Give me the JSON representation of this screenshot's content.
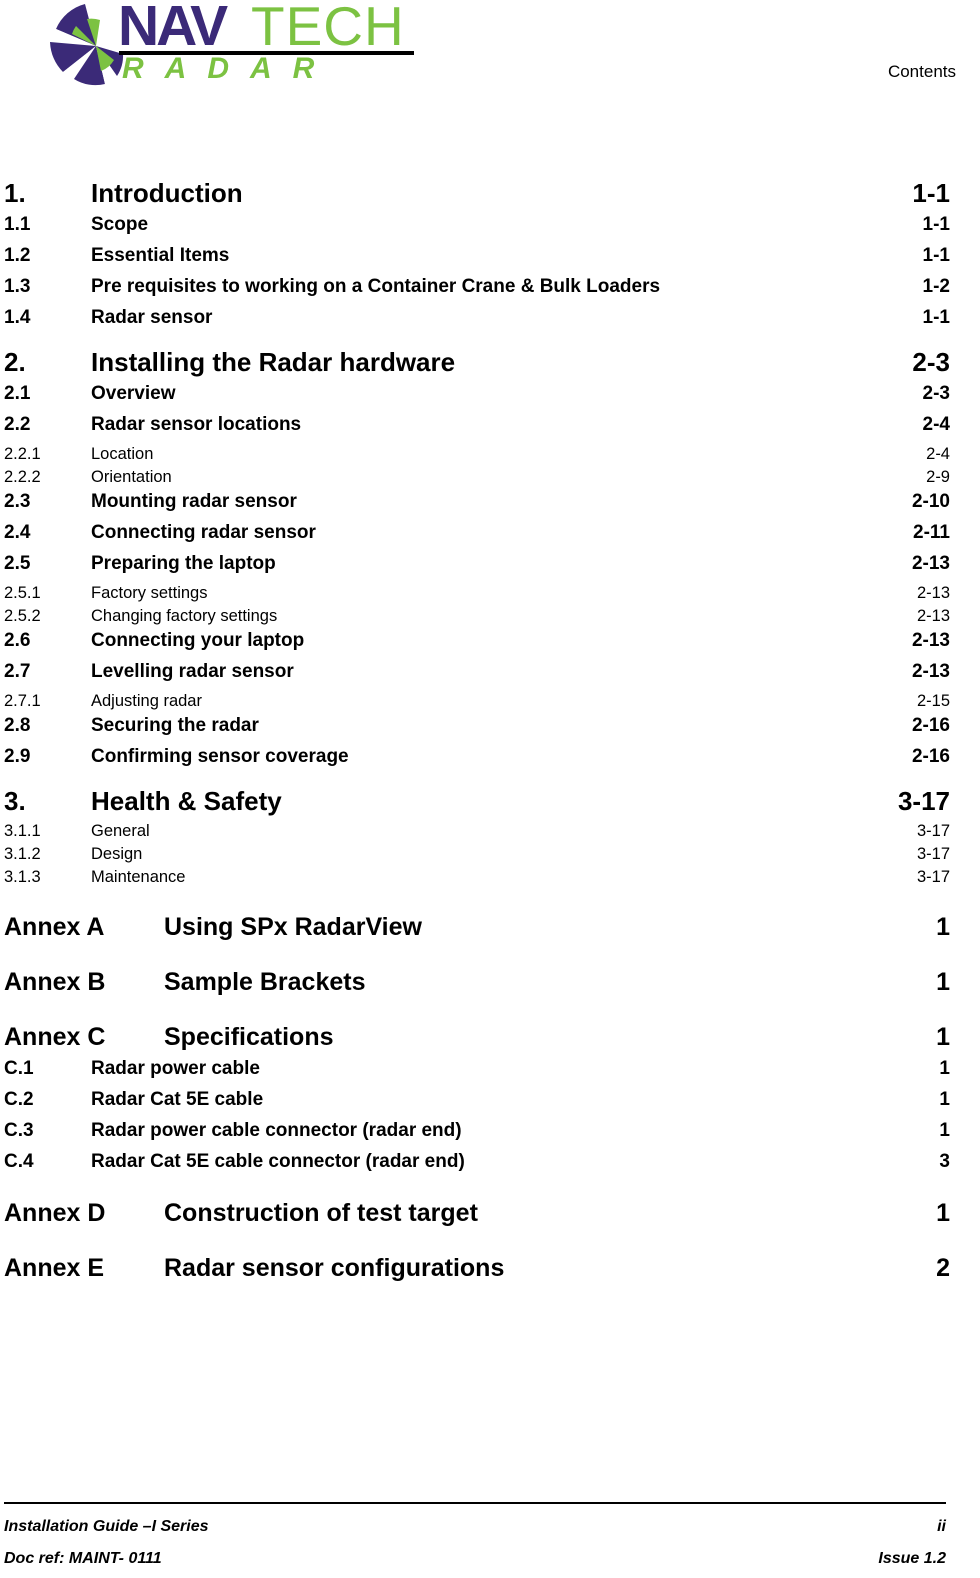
{
  "header": {
    "logo": {
      "mark_name": "navtech-radar-pinwheel-logo",
      "word_nav": "NAV",
      "word_tech": "TECH",
      "word_radar": "RADAR",
      "purple": "#3B2A78",
      "green": "#7CC242"
    },
    "title": "Contents"
  },
  "toc": {
    "entries": [
      {
        "level": 1,
        "number": "1.",
        "title": "Introduction",
        "page": "1-1",
        "gap": false
      },
      {
        "level": 2,
        "number": "1.1",
        "title": "Scope",
        "page": "1-1",
        "gap": false
      },
      {
        "level": 2,
        "number": "1.2",
        "title": "Essential Items",
        "page": "1-1",
        "gap": false
      },
      {
        "level": 2,
        "number": "1.3",
        "title": "Pre requisites to working on a Container Crane & Bulk Loaders",
        "page": "1-2",
        "gap": false
      },
      {
        "level": 2,
        "number": "1.4",
        "title": "Radar sensor",
        "page": "1-1",
        "gap": false
      },
      {
        "level": 1,
        "number": "2.",
        "title": "Installing the Radar hardware",
        "page": "2-3",
        "gap": false
      },
      {
        "level": 2,
        "number": "2.1",
        "title": "Overview",
        "page": "2-3",
        "gap": false
      },
      {
        "level": 2,
        "number": "2.2",
        "title": "Radar sensor locations",
        "page": "2-4",
        "gap": false
      },
      {
        "level": 3,
        "number": "2.2.1",
        "title": "Location",
        "page": "2-4",
        "gap": false
      },
      {
        "level": 3,
        "number": "2.2.2",
        "title": "Orientation",
        "page": "2-9",
        "gap": false
      },
      {
        "level": 2,
        "number": "2.3",
        "title": "Mounting radar sensor",
        "page": "2-10",
        "gap": false
      },
      {
        "level": 2,
        "number": "2.4",
        "title": "Connecting radar sensor",
        "page": "2-11",
        "gap": false
      },
      {
        "level": 2,
        "number": "2.5",
        "title": "Preparing the laptop",
        "page": "2-13",
        "gap": false
      },
      {
        "level": 3,
        "number": "2.5.1",
        "title": "Factory settings",
        "page": "2-13",
        "gap": false
      },
      {
        "level": 3,
        "number": "2.5.2",
        "title": "Changing factory settings",
        "page": "2-13",
        "gap": false
      },
      {
        "level": 2,
        "number": "2.6",
        "title": "Connecting your laptop",
        "page": "2-13",
        "gap": false
      },
      {
        "level": 2,
        "number": "2.7",
        "title": "Levelling radar sensor",
        "page": "2-13",
        "gap": false
      },
      {
        "level": 3,
        "number": "2.7.1",
        "title": "Adjusting radar",
        "page": "2-15",
        "gap": false
      },
      {
        "level": 2,
        "number": "2.8",
        "title": "Securing the radar",
        "page": "2-16",
        "gap": false
      },
      {
        "level": 2,
        "number": "2.9",
        "title": "Confirming sensor coverage",
        "page": "2-16",
        "gap": false
      },
      {
        "level": 1,
        "number": "3.",
        "title": "Health & Safety",
        "page": "3-17",
        "gap": false
      },
      {
        "level": 3,
        "number": "3.1.1",
        "title": "General",
        "page": "3-17",
        "gap": false
      },
      {
        "level": 3,
        "number": "3.1.2",
        "title": "Design",
        "page": "3-17",
        "gap": false
      },
      {
        "level": 3,
        "number": "3.1.3",
        "title": "Maintenance",
        "page": "3-17",
        "gap": false
      },
      {
        "level": 0,
        "number": "Annex A",
        "title": "Using SPx RadarView",
        "page": "1",
        "gap": false
      },
      {
        "level": 0,
        "number": "Annex B",
        "title": "Sample Brackets",
        "page": "1",
        "gap": false
      },
      {
        "level": 0,
        "number": "Annex C",
        "title": "Specifications",
        "page": "1",
        "gap": false
      },
      {
        "level": 4,
        "number": "C.1",
        "title": "Radar power cable",
        "page": "1",
        "gap": false
      },
      {
        "level": 4,
        "number": "C.2",
        "title": "Radar Cat 5E cable",
        "page": "1",
        "gap": false
      },
      {
        "level": 4,
        "number": "C.3",
        "title": "Radar power cable connector (radar end)",
        "page": "1",
        "gap": false
      },
      {
        "level": 4,
        "number": "C.4",
        "title": "Radar Cat 5E cable connector (radar end)",
        "page": "3",
        "gap": false
      },
      {
        "level": 0,
        "number": "Annex D",
        "title": "Construction of test target",
        "page": "1",
        "gap": false
      },
      {
        "level": 0,
        "number": "Annex E",
        "title": "Radar sensor configurations",
        "page": "2",
        "gap": false
      }
    ]
  },
  "footer": {
    "left_line_1": "Installation Guide –I Series",
    "right_line_1": "ii",
    "left_line_2": "Doc ref: MAINT- 0111",
    "right_line_2": "Issue 1.2"
  }
}
